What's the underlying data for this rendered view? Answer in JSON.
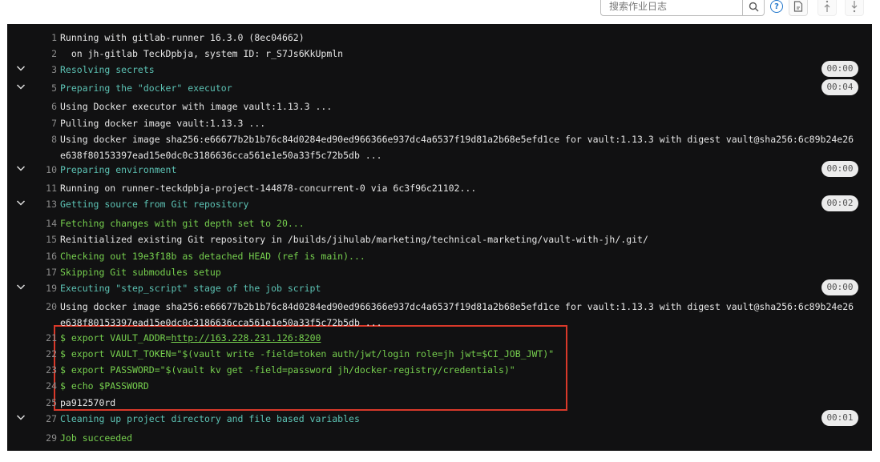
{
  "toolbar": {
    "search_placeholder": "搜索作业日志",
    "search_icon": "search-icon",
    "help_label": "?",
    "raw_icon": "file-text-icon",
    "scroll_top_icon": "scroll-top-icon",
    "scroll_bottom_icon": "scroll-bottom-icon"
  },
  "colors": {
    "section": "#5cc2b4",
    "command": "#76cf4e",
    "highlight_box": "#d9392a"
  },
  "log": [
    {
      "n": "1",
      "text": "Running with gitlab-runner 16.3.0 (8ec04662)"
    },
    {
      "n": "2",
      "text": "  on jh-gitlab TeckDpbja, system ID: r_S7Js6KkUpmln"
    },
    {
      "n": "3",
      "text": "Resolving secrets",
      "kind": "section",
      "duration": "00:00"
    },
    {
      "n": "5",
      "text": "Preparing the \"docker\" executor",
      "kind": "section",
      "duration": "00:04"
    },
    {
      "n": "6",
      "text": "Using Docker executor with image vault:1.13.3 ..."
    },
    {
      "n": "7",
      "text": "Pulling docker image vault:1.13.3 ..."
    },
    {
      "n": "8",
      "text": "Using docker image sha256:e66677b2b1b76c84d0284ed90ed966366e937dc4a6537f19d81a2b68e5efd1ce for vault:1.13.3 with digest vault@sha256:6c89b24e26",
      "cont": "e638f80153397ead15e0dc0c3186636cca561e1e50a33f5c72b5db ..."
    },
    {
      "n": "10",
      "text": "Preparing environment",
      "kind": "section",
      "duration": "00:00"
    },
    {
      "n": "11",
      "text": "Running on runner-teckdpbja-project-144878-concurrent-0 via 6c3f96c21102..."
    },
    {
      "n": "13",
      "text": "Getting source from Git repository",
      "kind": "section",
      "duration": "00:02"
    },
    {
      "n": "14",
      "text": "Fetching changes with git depth set to 20...",
      "kind": "green"
    },
    {
      "n": "15",
      "text": "Reinitialized existing Git repository in /builds/jihulab/marketing/technical-marketing/vault-with-jh/.git/"
    },
    {
      "n": "16",
      "text": "Checking out 19e3f18b as detached HEAD (ref is main)...",
      "kind": "green"
    },
    {
      "n": "17",
      "text": "Skipping Git submodules setup",
      "kind": "green"
    },
    {
      "n": "19",
      "text": "Executing \"step_script\" stage of the job script",
      "kind": "section",
      "duration": "00:00"
    },
    {
      "n": "20",
      "text": "Using docker image sha256:e66677b2b1b76c84d0284ed90ed966366e937dc4a6537f19d81a2b68e5efd1ce for vault:1.13.3 with digest vault@sha256:6c89b24e26",
      "cont": "e638f80153397ead15e0dc0c3186636cca561e1e50a33f5c72b5db ..."
    },
    {
      "n": "21",
      "text": "$ export VAULT_ADDR=",
      "link": "http://163.228.231.126:8200",
      "kind": "green"
    },
    {
      "n": "22",
      "text": "$ export VAULT_TOKEN=\"$(vault write -field=token auth/jwt/login role=jh jwt=$CI_JOB_JWT)\"",
      "kind": "green"
    },
    {
      "n": "23",
      "text": "$ export PASSWORD=\"$(vault kv get -field=password jh/docker-registry/credentials)\"",
      "kind": "green"
    },
    {
      "n": "24",
      "text": "$ echo $PASSWORD",
      "kind": "green"
    },
    {
      "n": "25",
      "text": "pa912570rd"
    },
    {
      "n": "27",
      "text": "Cleaning up project directory and file based variables",
      "kind": "section",
      "duration": "00:01"
    },
    {
      "n": "29",
      "text": "Job succeeded",
      "kind": "green"
    }
  ]
}
